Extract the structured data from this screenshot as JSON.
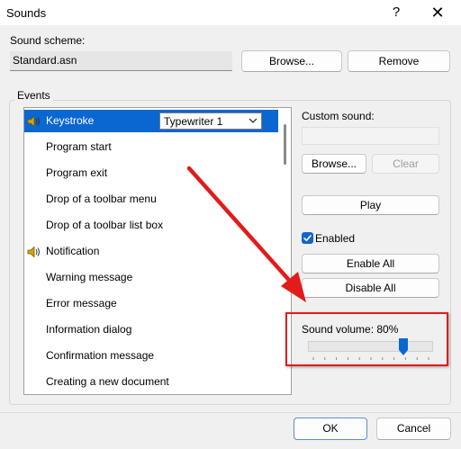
{
  "window": {
    "title": "Sounds",
    "help_label": "?",
    "close_label": "✕"
  },
  "scheme": {
    "label": "Sound scheme:",
    "value": "Standard.asn",
    "browse_label": "Browse...",
    "remove_label": "Remove"
  },
  "events": {
    "group_label": "Events",
    "selected_index": 0,
    "items": [
      {
        "label": "Keystroke",
        "icon": "speaker-icon"
      },
      {
        "label": "Program start",
        "icon": ""
      },
      {
        "label": "Program exit",
        "icon": ""
      },
      {
        "label": "Drop of a toolbar menu",
        "icon": ""
      },
      {
        "label": "Drop of a toolbar list box",
        "icon": ""
      },
      {
        "label": "Notification",
        "icon": "speaker-icon"
      },
      {
        "label": "Warning message",
        "icon": ""
      },
      {
        "label": "Error message",
        "icon": ""
      },
      {
        "label": "Information dialog",
        "icon": ""
      },
      {
        "label": "Confirmation message",
        "icon": ""
      },
      {
        "label": "Creating a new document",
        "icon": ""
      }
    ],
    "keystroke_sound": "Typewriter 1"
  },
  "custom_sound": {
    "label": "Custom sound:",
    "value": "",
    "browse_label": "Browse...",
    "clear_label": "Clear"
  },
  "play_label": "Play",
  "enabled": {
    "label": "Enabled",
    "checked": true
  },
  "enable_all_label": "Enable All",
  "disable_all_label": "Disable All",
  "volume": {
    "label": "Sound volume: 80%",
    "value": 0.8
  },
  "footer": {
    "ok_label": "OK",
    "cancel_label": "Cancel"
  },
  "colors": {
    "accent": "#0a67d2",
    "highlight_red": "#e21b1b"
  }
}
